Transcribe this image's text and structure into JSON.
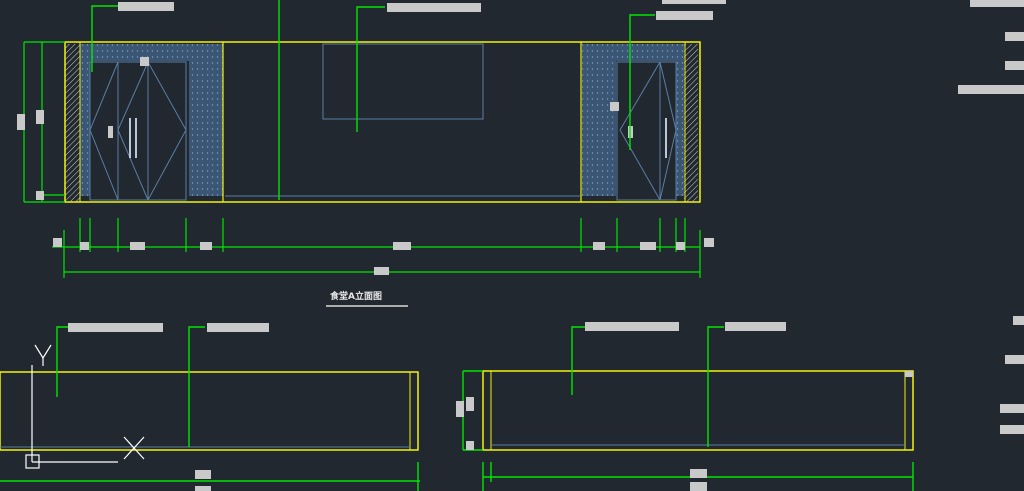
{
  "drawing": {
    "elevation_title": "食堂A立面图",
    "axis_y_label": "Y",
    "axis_x_label": "X"
  },
  "colors": {
    "background": "#212830",
    "outline": "#f2f20a",
    "leader": "#00e600",
    "panel_fill": "#3b5574",
    "thin_line": "#5a7ea3",
    "label_block": "#c9c9c9",
    "ucs_icon": "#ffffff"
  }
}
